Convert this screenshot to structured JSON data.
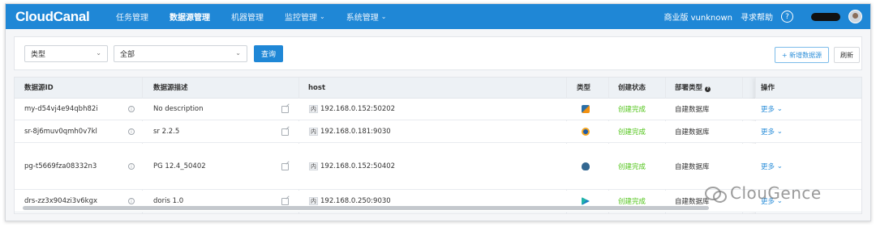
{
  "navbar": {
    "logo": "CloudCanal",
    "items": [
      {
        "label": "任务管理"
      },
      {
        "label": "数据源管理"
      },
      {
        "label": "机器管理"
      },
      {
        "label": "监控管理"
      },
      {
        "label": "系统管理"
      }
    ],
    "edition": "商业版 vunknown",
    "help": "寻求帮助",
    "help_icon": "?"
  },
  "filters": {
    "type_value": "类型",
    "all_value": "全部",
    "query_button": "查询",
    "add_button": "+ 新增数据源",
    "refresh_button": "刷新"
  },
  "table": {
    "headers": {
      "id": "数据源ID",
      "desc": "数据源描述",
      "host": "host",
      "type": "类型",
      "status": "创建状态",
      "deploy": "部署类型",
      "ops": "操作"
    },
    "net_tag": "内",
    "rows": [
      {
        "id": "my-d54vj4e94qbh82i",
        "desc": "No description",
        "host": "192.168.0.152:50202",
        "type_icon": "mysql-icon",
        "status": "创建完成",
        "deploy": "自建数据库",
        "op": "更多"
      },
      {
        "id": "sr-8j6muv0qmh0v7kl",
        "desc": "sr 2.2.5",
        "host": "192.168.0.181:9030",
        "type_icon": "starrocks-icon",
        "status": "创建完成",
        "deploy": "自建数据库",
        "op": "更多"
      },
      {
        "id": "pg-t5669fza08332n3",
        "desc": "PG 12.4_50402",
        "host": "192.168.0.152:50402",
        "type_icon": "postgresql-icon",
        "status": "创建完成",
        "deploy": "自建数据库",
        "op": "更多"
      },
      {
        "id": "drs-zz3x904zi3v6kgx",
        "desc": "doris 1.0",
        "host": "192.168.0.250:9030",
        "type_icon": "doris-icon",
        "status": "创建完成",
        "deploy": "自建数据库",
        "op": "更多"
      }
    ]
  },
  "watermark": "ClouGence",
  "colors": {
    "brand": "#1f87d6",
    "success": "#52c41a",
    "link": "#2d8fd9"
  }
}
